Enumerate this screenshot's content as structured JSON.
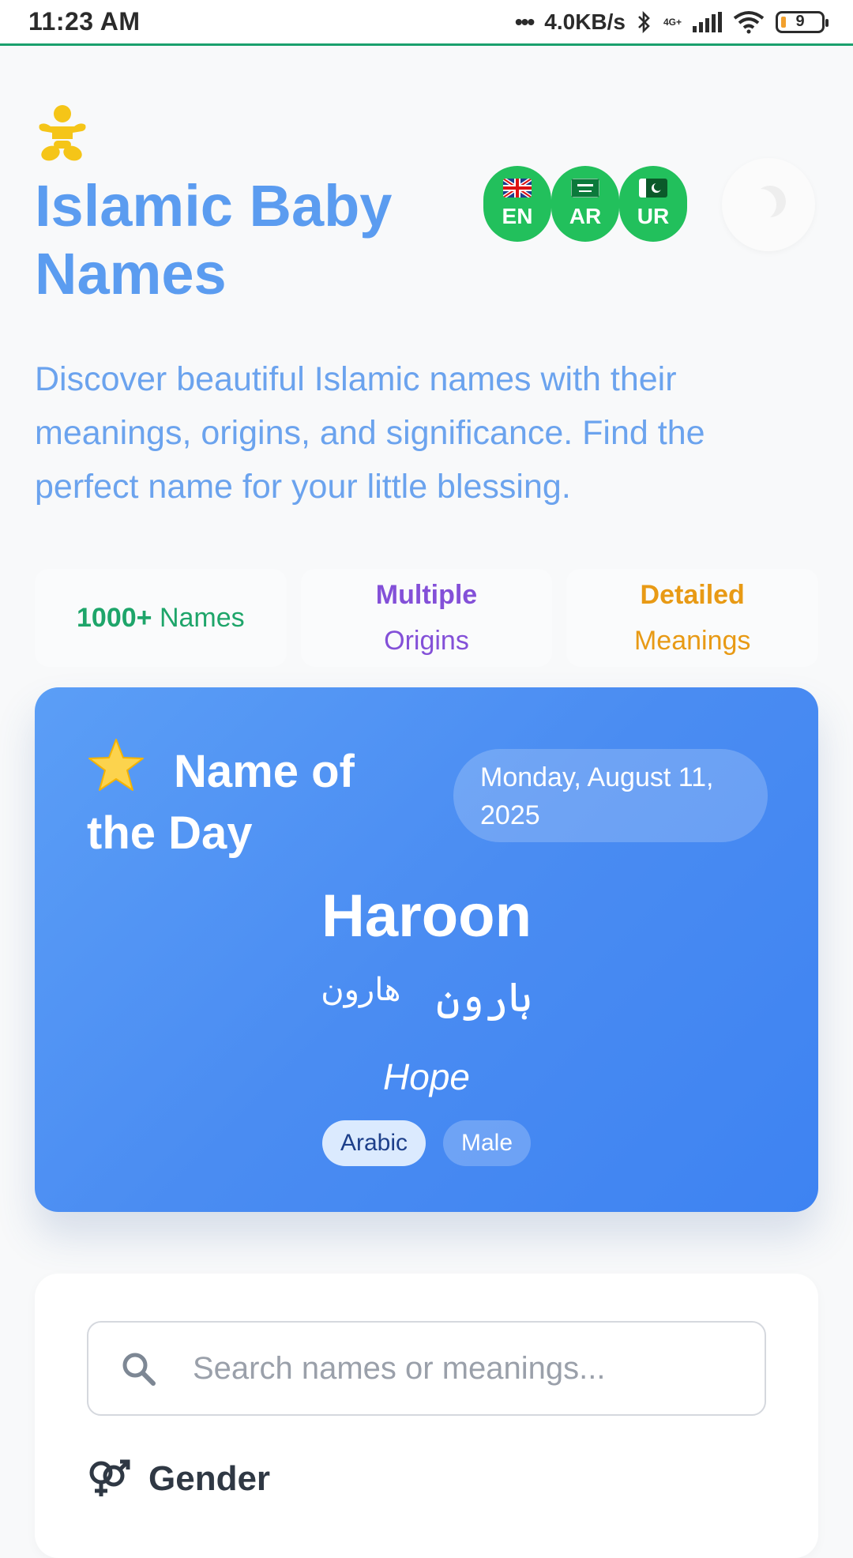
{
  "status_bar": {
    "time": "11:23 AM",
    "speed": "4.0KB/s",
    "network": "4G+",
    "battery": "9"
  },
  "header": {
    "title": "Islamic Baby Names",
    "languages": [
      {
        "code": "EN",
        "flag": "uk-flag-icon"
      },
      {
        "code": "AR",
        "flag": "saudi-flag-icon"
      },
      {
        "code": "UR",
        "flag": "pakistan-flag-icon"
      }
    ],
    "theme_icon": "moon-icon"
  },
  "subtitle": "Discover beautiful Islamic names with their meanings, origins, and significance. Find the perfect name for your little blessing.",
  "stats": [
    {
      "strong": "1000+",
      "text": " Names",
      "color": "#1ea56a"
    },
    {
      "strong": "Multiple",
      "text": "Origins",
      "color": "#8350d8"
    },
    {
      "strong": "Detailed",
      "text": "Meanings",
      "color": "#e89a15"
    }
  ],
  "name_of_day": {
    "heading": "Name of the Day",
    "date": "Monday, August 11, 2025",
    "name": "Haroon",
    "arabic": "ہارون",
    "urdu": "هارون",
    "meaning": "Hope",
    "tags": {
      "origin": "Arabic",
      "gender": "Male"
    }
  },
  "filters": {
    "search_placeholder": "Search names or meanings...",
    "search_value": "",
    "gender_label": "Gender"
  },
  "colors": {
    "title": "#5b9cf0",
    "lang_button": "#22c05c",
    "card_gradient_start": "#5b9ef6",
    "card_gradient_end": "#3e83f2"
  }
}
